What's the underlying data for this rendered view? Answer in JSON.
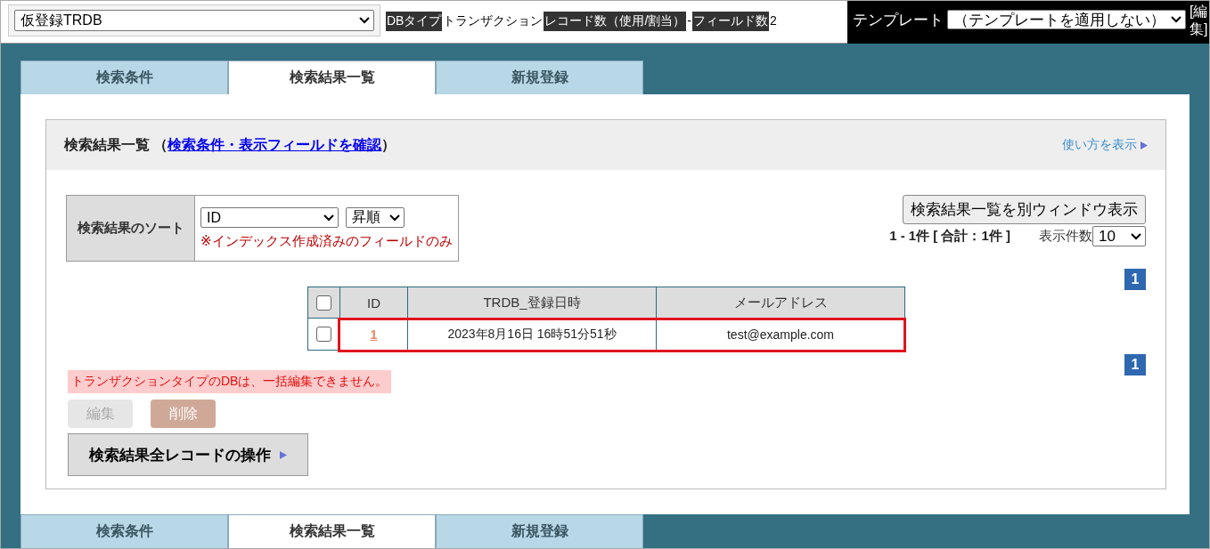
{
  "db_select": {
    "value": "仮登録TRDB"
  },
  "db_info": [
    {
      "kind": "label",
      "text": "DBタイプ"
    },
    {
      "kind": "value",
      "text": "トランザクション"
    },
    {
      "kind": "label",
      "text": "レコード数（使用/割当）"
    },
    {
      "kind": "value",
      "text": "-"
    },
    {
      "kind": "label",
      "text": "フィールド数"
    },
    {
      "kind": "value",
      "text": "2"
    }
  ],
  "template": {
    "label": "テンプレート",
    "value": "（テンプレートを適用しない）",
    "edit_link": "[編集]"
  },
  "tabs": [
    {
      "label": "検索条件",
      "selected": false
    },
    {
      "label": "検索結果一覧",
      "selected": true
    },
    {
      "label": "新規登録",
      "selected": false
    }
  ],
  "panel": {
    "title": "検索結果一覧",
    "title_open": "（",
    "title_link": "検索条件・表示フィールドを確認",
    "title_close": "）",
    "help_link": "使い方を表示"
  },
  "sort": {
    "label": "検索結果のソート",
    "field": "ID",
    "order": "昇順",
    "note": "※インデックス作成済みのフィールドのみ"
  },
  "popup_button": "検索結果一覧を別ウィンドウ表示",
  "count": "1 - 1件 [ 合計：1件 ]",
  "page_size": {
    "label": "表示件数",
    "value": "10"
  },
  "pages_top": [
    {
      "label": "1",
      "selected": true
    }
  ],
  "table": {
    "select_all_checked": false,
    "columns": [
      "ID",
      "TRDB_登録日時",
      "メールアドレス"
    ],
    "rows": [
      {
        "checked": false,
        "highlighted": true,
        "cells": [
          "1",
          "2023年8月16日 16時51分51秒",
          "test@example.com"
        ]
      }
    ]
  },
  "pages_bottom": [
    {
      "label": "1",
      "selected": true
    }
  ],
  "warning": "トランザクションタイプのDBは、一括編集できません。",
  "actions": [
    {
      "label": "編集",
      "kind": "edit",
      "disabled": true
    },
    {
      "label": "削除",
      "kind": "delete",
      "disabled": true
    }
  ],
  "bulk_button": "検索結果全レコードの操作",
  "bottom_tabs": [
    {
      "label": "検索条件",
      "selected": false
    },
    {
      "label": "検索結果一覧",
      "selected": true
    },
    {
      "label": "新規登録",
      "selected": false
    }
  ]
}
